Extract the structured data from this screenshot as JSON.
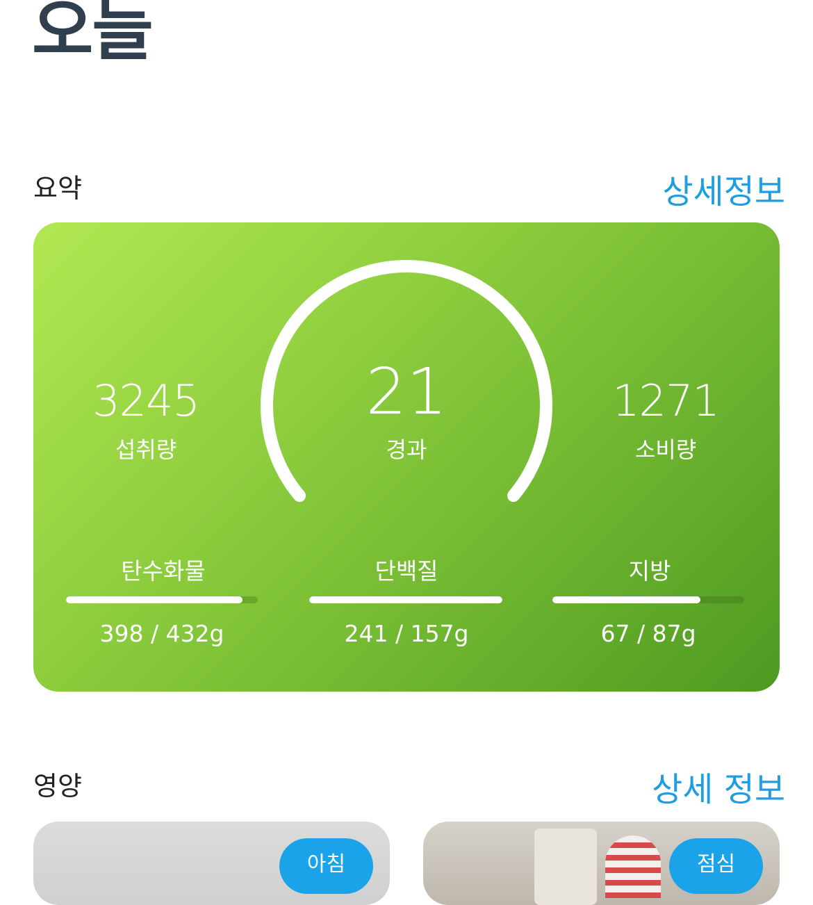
{
  "page": {
    "title": "오늘"
  },
  "summary": {
    "title": "요약",
    "detail_link": "상세정보",
    "intake": {
      "value": "3245",
      "label": "섭취량"
    },
    "elapsed": {
      "value": "21",
      "label": "경과"
    },
    "burned": {
      "value": "1271",
      "label": "소비량"
    },
    "gauge_progress": 1.0,
    "macros": [
      {
        "label": "탄수화물",
        "value_text": "398 / 432g",
        "current": 398,
        "goal": 432
      },
      {
        "label": "단백질",
        "value_text": "241 / 157g",
        "current": 241,
        "goal": 157
      },
      {
        "label": "지방",
        "value_text": "67 / 87g",
        "current": 67,
        "goal": 87
      }
    ]
  },
  "nutrition": {
    "title": "영양",
    "detail_link": "상세 정보",
    "meals": [
      {
        "badge": "아침"
      },
      {
        "badge": "점심"
      }
    ]
  },
  "colors": {
    "accent": "#1e9ee0",
    "badge": "#1aa3e8",
    "card_gradient_start": "#b2e852",
    "card_gradient_end": "#4d9a22",
    "title": "#2f3f4d"
  }
}
